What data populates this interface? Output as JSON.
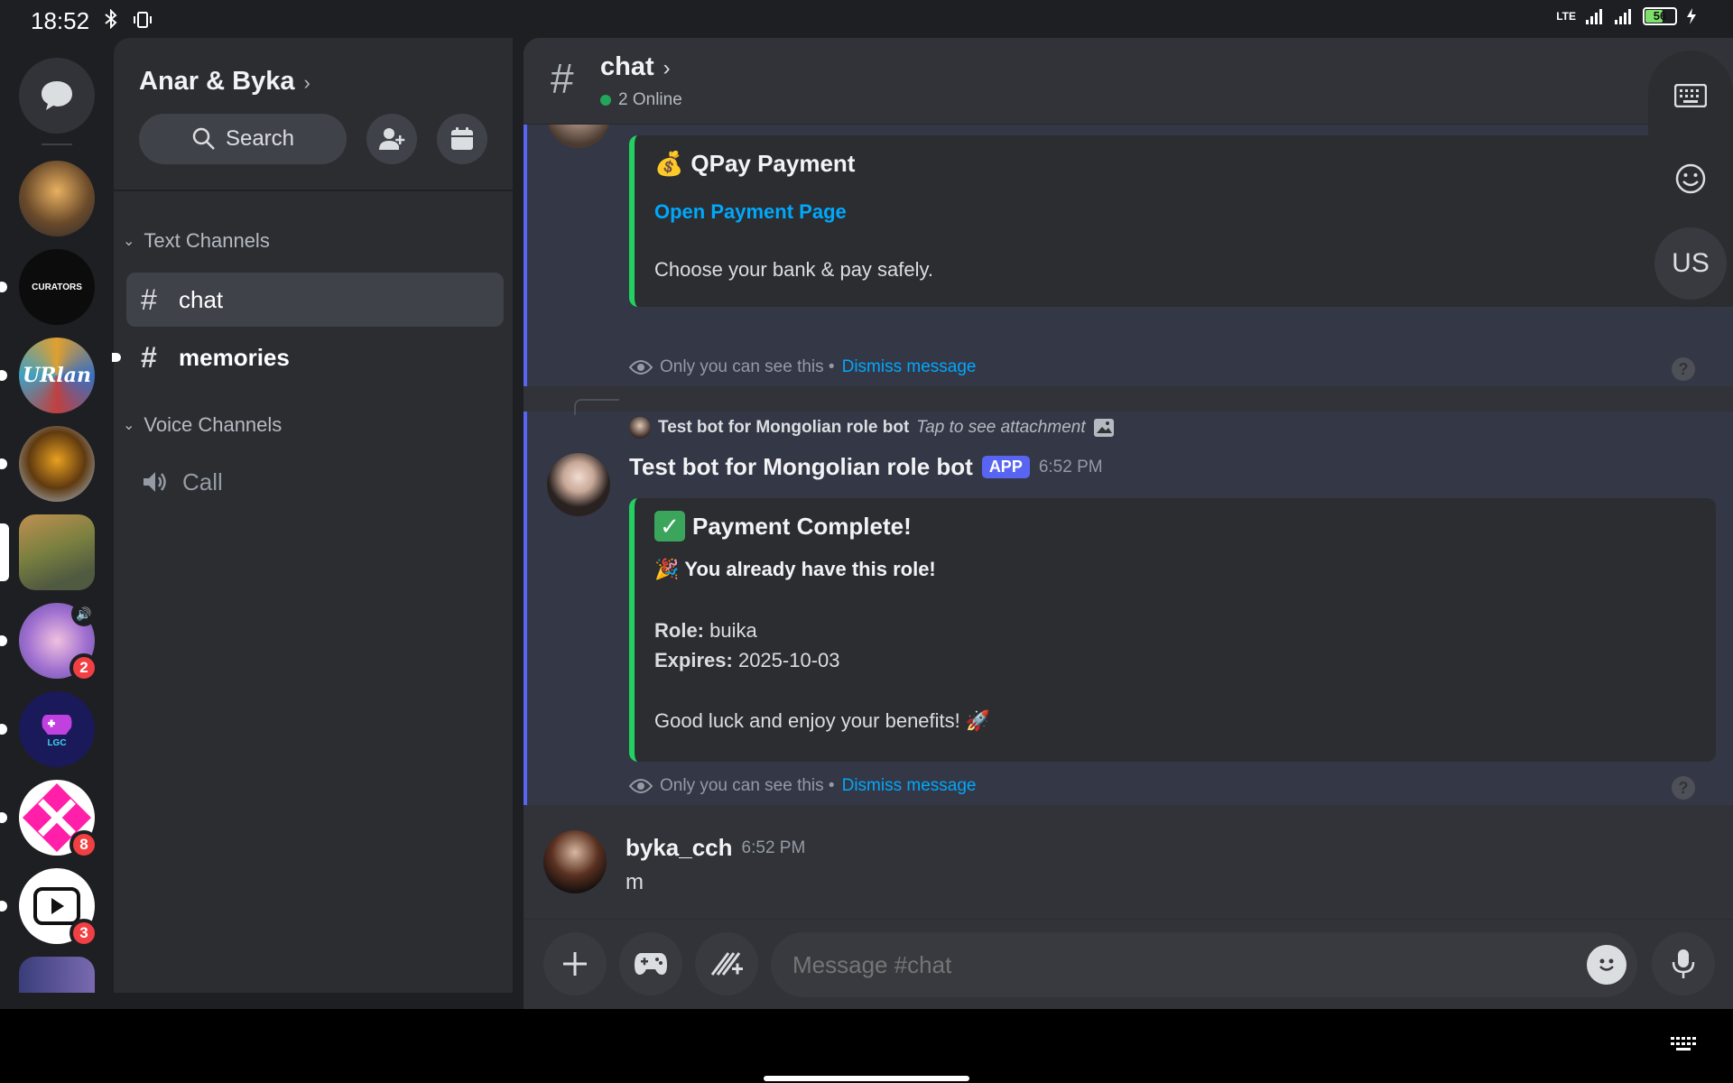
{
  "status_bar": {
    "time": "18:52",
    "left_icons": [
      "bluetooth-icon",
      "vibrate-icon"
    ],
    "network": "LTE",
    "battery": "56",
    "battery_level": 0.56
  },
  "server_rail": {
    "servers": [
      {
        "name": "server-house",
        "badge": ""
      },
      {
        "name": "server-curators",
        "label": "CURATORS",
        "badge": ""
      },
      {
        "name": "server-urlan",
        "label": "URlan",
        "badge": ""
      },
      {
        "name": "server-knight",
        "badge": ""
      },
      {
        "name": "server-gazebo",
        "badge": ""
      },
      {
        "name": "server-anime",
        "badge": "2"
      },
      {
        "name": "server-lgc",
        "label": "LGC",
        "badge": ""
      },
      {
        "name": "server-pink",
        "badge": "8"
      },
      {
        "name": "server-video",
        "badge": "3"
      }
    ]
  },
  "sidebar": {
    "guild_name": "Anar & Byka",
    "search_label": "Search",
    "categories": {
      "text": "Text Channels",
      "voice": "Voice Channels"
    },
    "channels": [
      {
        "name": "chat",
        "type": "text",
        "active": true
      },
      {
        "name": "memories",
        "type": "text",
        "unread": true
      },
      {
        "name": "Call",
        "type": "voice"
      }
    ]
  },
  "header": {
    "channel": "chat",
    "online": "2 Online"
  },
  "floating_panel": {
    "lang": "US"
  },
  "messages": {
    "qpay": {
      "title": "QPay Payment",
      "link": "Open Payment Page",
      "text": "Choose your bank & pay safely.",
      "only_you": "Only you can see this •",
      "dismiss": "Dismiss message"
    },
    "payment": {
      "reply_author": "Test bot for Mongolian role bot",
      "reply_text": "Tap to see attachment",
      "author": "Test bot for Mongolian role bot",
      "tag": "APP",
      "time": "6:52 PM",
      "title": "Payment Complete!",
      "subtitle": "You already have this role!",
      "role_label": "Role:",
      "role_value": "buika",
      "expires_label": "Expires:",
      "expires_value": "2025-10-03",
      "footer": "Good luck and enjoy your benefits!",
      "only_you": "Only you can see this •",
      "dismiss": "Dismiss message"
    },
    "user": {
      "author": "byka_cch",
      "time": "6:52 PM",
      "text": "m"
    }
  },
  "composer": {
    "placeholder": "Message #chat"
  },
  "colors": {
    "accent": "#5865f2",
    "embed_bar": "#23d160",
    "link": "#00a8fc",
    "badge": "#f23f43"
  }
}
